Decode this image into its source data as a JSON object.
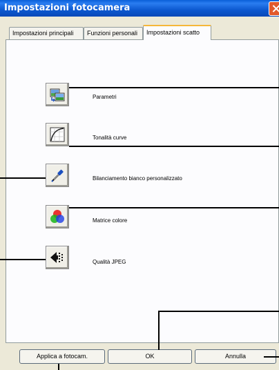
{
  "window": {
    "title": "Impostazioni fotocamera"
  },
  "tabs": [
    {
      "label": "Impostazioni principali"
    },
    {
      "label": "Funzioni personali"
    },
    {
      "label": "Impostazioni scatto",
      "active": true
    }
  ],
  "items": [
    {
      "label": "Parametri",
      "icon": "parameters-icon"
    },
    {
      "label": "Tonalità curve",
      "icon": "tone-curve-icon"
    },
    {
      "label": "Bilanciamento bianco personalizzato",
      "icon": "eyedropper-icon"
    },
    {
      "label": "Matrice colore",
      "icon": "color-matrix-icon"
    },
    {
      "label": "Qualità JPEG",
      "icon": "jpeg-quality-icon"
    }
  ],
  "buttons": {
    "apply": "Applica a fotocam.",
    "ok": "OK",
    "cancel": "Annulla"
  },
  "colors": {
    "title_bar": "#0a5fd8",
    "active_tab_accent": "#f5b73a",
    "close_button": "#e25a2c"
  }
}
